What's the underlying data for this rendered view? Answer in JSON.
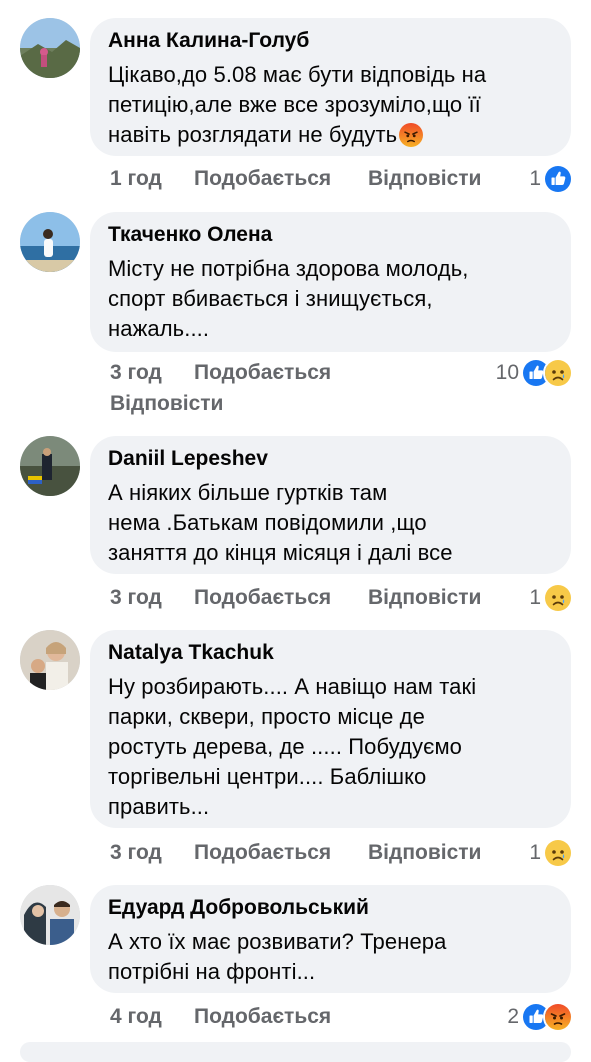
{
  "comments": [
    {
      "author": "Анна Калина-Голуб",
      "lines": [
        "Цікаво,до 5.08 має бути відповідь на",
        "петицію,але вже все зрозуміло,що її",
        "навіть розглядати не будуть"
      ],
      "trailing_emoji": "angry-face",
      "time": "1 год",
      "like_label": "Подобається",
      "reply_label": "Відповісти",
      "reaction_count": "1",
      "reactions": [
        "like"
      ]
    },
    {
      "author": "Ткаченко Олена",
      "lines": [
        "Місту не потрібна здорова молодь,",
        "спорт вбивається і знищується,",
        "нажаль...."
      ],
      "time": "3 год",
      "like_label": "Подобається",
      "reply_label": "Відповісти",
      "reaction_count": "10",
      "reactions": [
        "like",
        "sad"
      ]
    },
    {
      "author": "Daniil  Lepeshev",
      "lines": [
        "А ніяких більше гуртків там",
        "нема .Батькам повідомили ,що",
        "заняття до кінця місяця і далі все"
      ],
      "time": "3 год",
      "like_label": "Подобається",
      "reply_label": "Відповісти",
      "reaction_count": "1",
      "reactions": [
        "sad"
      ]
    },
    {
      "author": "Natalya  Tkachuk",
      "lines": [
        "Ну розбирають.... А навіщо нам такі",
        "парки, сквери, просто місце де",
        "ростуть дерева, де ..... Побудуємо",
        "торгівельні центри.... Баблішко",
        "править..."
      ],
      "time": "3 год",
      "like_label": "Подобається",
      "reply_label": "Відповісти",
      "reaction_count": "1",
      "reactions": [
        "sad"
      ]
    },
    {
      "author": "Едуард Добровольський",
      "lines": [
        "А хто їх має розвивати? Тренера",
        "потрібні на фронті..."
      ],
      "time": "4 год",
      "like_label": "Подобається",
      "reaction_count": "2",
      "reactions": [
        "like",
        "angry"
      ]
    }
  ],
  "colors": {
    "bubble": "#f0f2f5",
    "meta_text": "#65676b",
    "like_blue": "#1877f2",
    "sad_yellow": "#f7c948",
    "angry_red": "#e9710f"
  }
}
